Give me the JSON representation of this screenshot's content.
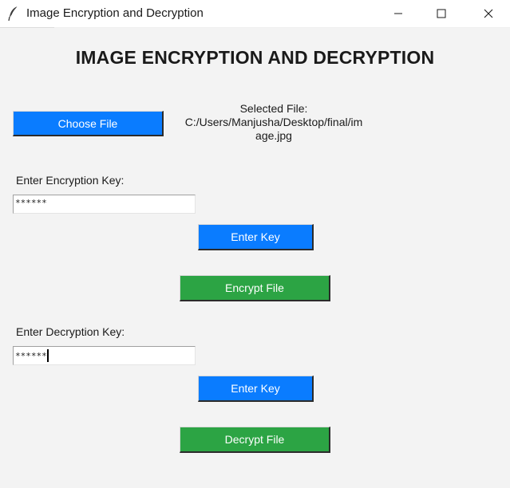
{
  "window": {
    "title": "Image Encryption and Decryption"
  },
  "app": {
    "heading": "IMAGE ENCRYPTION AND DECRYPTION",
    "choose_file_label": "Choose File",
    "selected_file_caption": "Selected File:",
    "selected_file_path_line1": "C:/Users/Manjusha/Desktop/final/im",
    "selected_file_path_line2": "age.jpg",
    "encryption": {
      "label": "Enter Encryption Key:",
      "key_value": "******",
      "enter_key_label": "Enter Key",
      "action_label": "Encrypt File"
    },
    "decryption": {
      "label": "Enter Decryption Key:",
      "key_value": "******",
      "enter_key_label": "Enter Key",
      "action_label": "Decrypt File"
    }
  },
  "colors": {
    "blue_button": "#0a7cff",
    "green_button": "#2ca444"
  },
  "icons": {
    "app": "feather-icon",
    "minimize": "minimize-icon",
    "maximize": "maximize-icon",
    "close": "close-icon"
  }
}
